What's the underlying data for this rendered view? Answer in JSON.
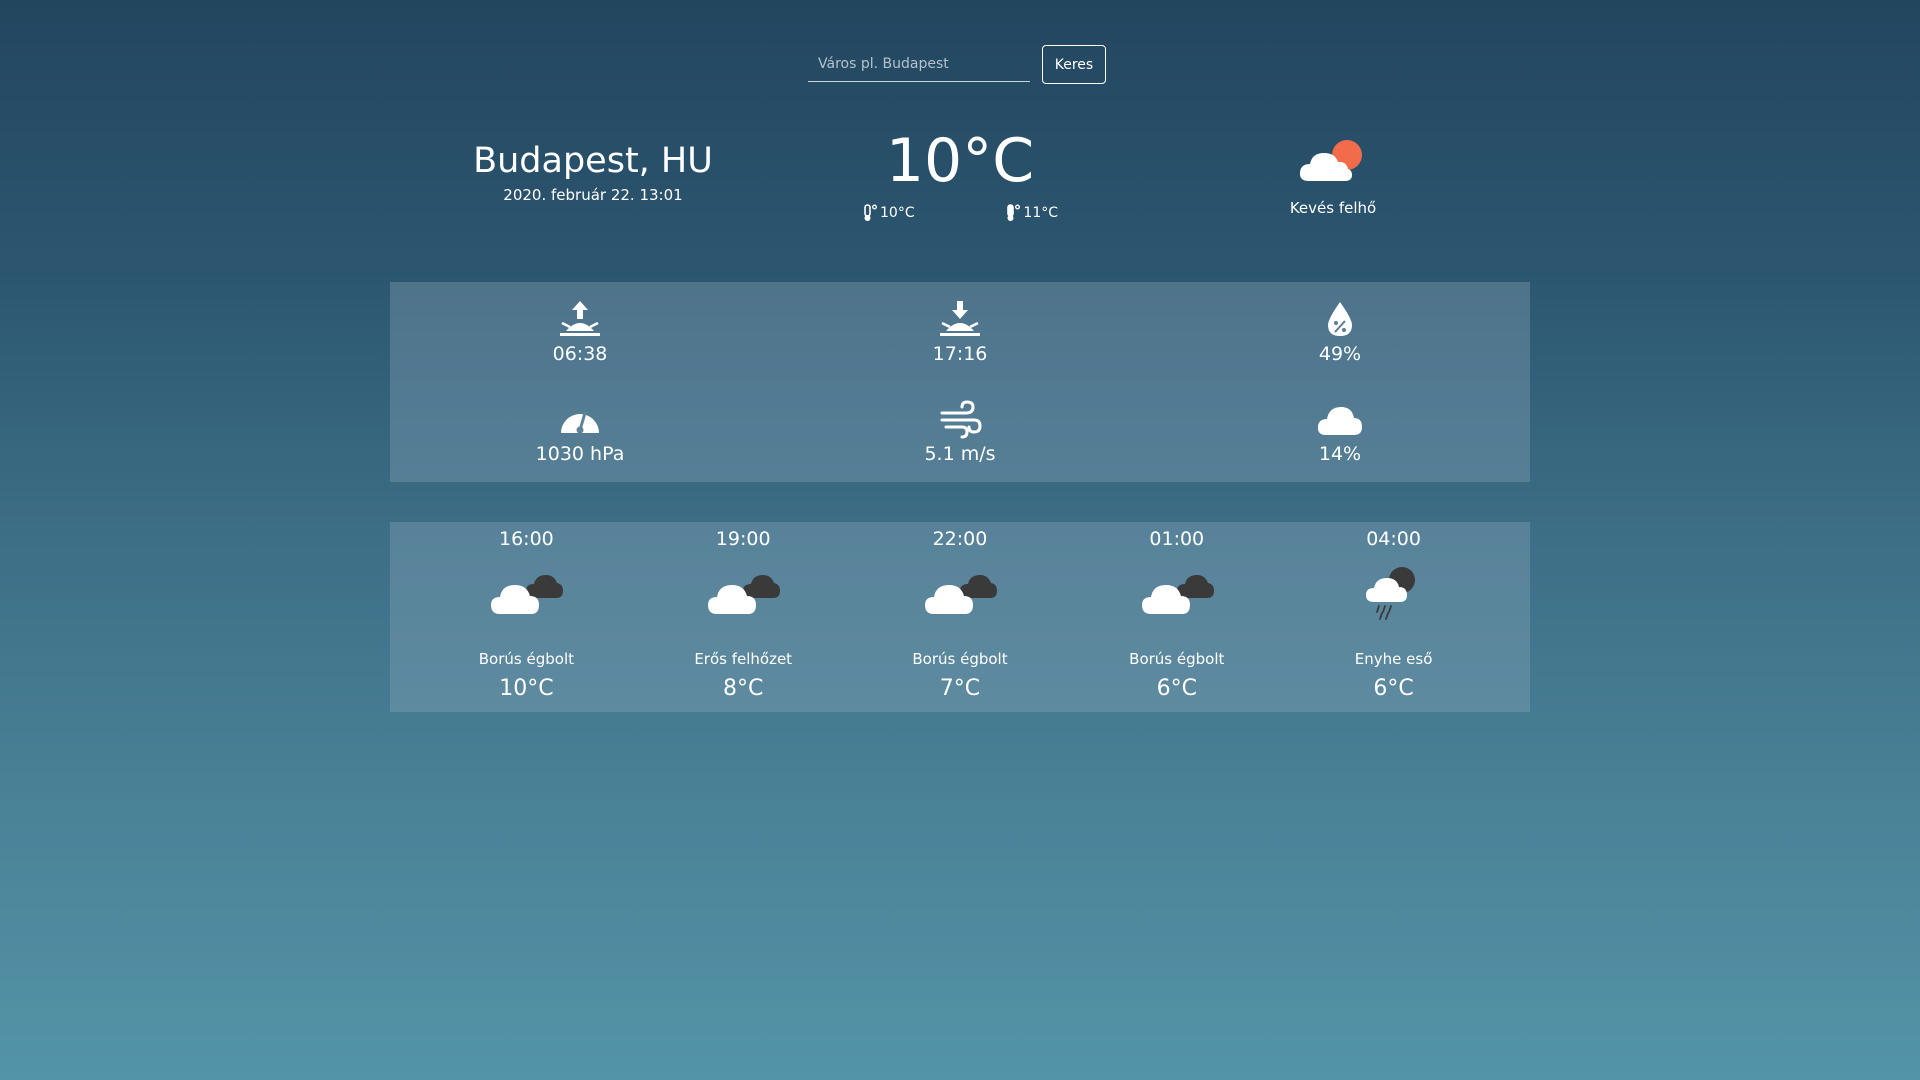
{
  "search": {
    "placeholder": "Város pl. Budapest",
    "value": "",
    "button_label": "Keres"
  },
  "current": {
    "city": "Budapest, HU",
    "datetime": "2020. február 22. 13:01",
    "temperature": "10°C",
    "temp_min": "10°C",
    "temp_max": "11°C",
    "condition": "Kevés felhő",
    "condition_icon": "few-clouds-day-icon"
  },
  "stats": {
    "sunrise": {
      "icon": "sunrise-icon",
      "value": "06:38"
    },
    "sunset": {
      "icon": "sunset-icon",
      "value": "17:16"
    },
    "humidity": {
      "icon": "humidity-drop-icon",
      "value": "49%"
    },
    "pressure": {
      "icon": "barometer-icon",
      "value": "1030 hPa"
    },
    "wind": {
      "icon": "wind-icon",
      "value": "5.1 m/s"
    },
    "cloudiness": {
      "icon": "cloud-icon",
      "value": "14%"
    }
  },
  "forecast": [
    {
      "time": "16:00",
      "description": "Borús égbolt",
      "temp": "10°C",
      "icon": "overcast-clouds-icon"
    },
    {
      "time": "19:00",
      "description": "Erős felhőzet",
      "temp": "8°C",
      "icon": "broken-clouds-icon"
    },
    {
      "time": "22:00",
      "description": "Borús égbolt",
      "temp": "7°C",
      "icon": "overcast-clouds-icon"
    },
    {
      "time": "01:00",
      "description": "Borús égbolt",
      "temp": "6°C",
      "icon": "overcast-clouds-icon"
    },
    {
      "time": "04:00",
      "description": "Enyhe eső",
      "temp": "6°C",
      "icon": "light-rain-icon"
    }
  ],
  "colors": {
    "sun": "#f26b4a",
    "cloud_light": "#ffffff",
    "cloud_dark": "#3a3a3a"
  }
}
